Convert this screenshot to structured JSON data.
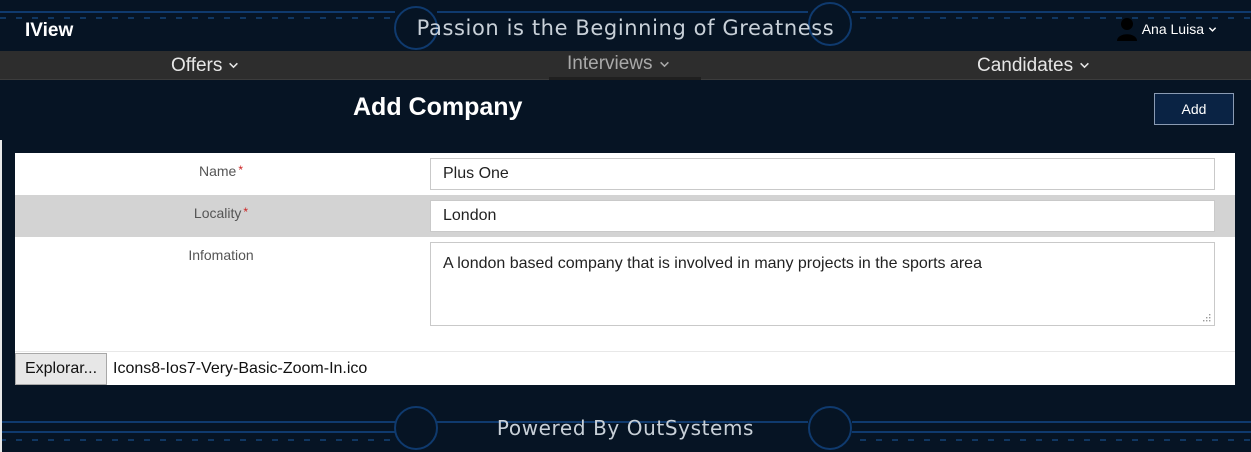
{
  "header": {
    "brand": "IView",
    "tagline": "Passion is the Beginning of Greatness",
    "user_name": "Ana Luisa"
  },
  "nav": {
    "items": [
      {
        "label": "Offers"
      },
      {
        "label": "Interviews"
      },
      {
        "label": "Candidates"
      }
    ]
  },
  "page": {
    "title": "Add Company",
    "add_button": "Add"
  },
  "form": {
    "name_label": "Name",
    "name_required": "*",
    "name_value": "Plus One",
    "locality_label": "Locality",
    "locality_required": "*",
    "locality_value": "London",
    "information_label": "Infomation",
    "information_value": "A london based company that is involved in many projects in the sports area",
    "browse_button": "Explorar...",
    "file_name": "Icons8-Ios7-Very-Basic-Zoom-In.ico"
  },
  "footer": {
    "text": "Powered By OutSystems"
  },
  "colors": {
    "background": "#061424",
    "nav_bar": "#2d2d2d",
    "add_button_bg": "#0a2344",
    "highlight_row": "#d3d3d3",
    "required_mark": "#cc2222"
  }
}
